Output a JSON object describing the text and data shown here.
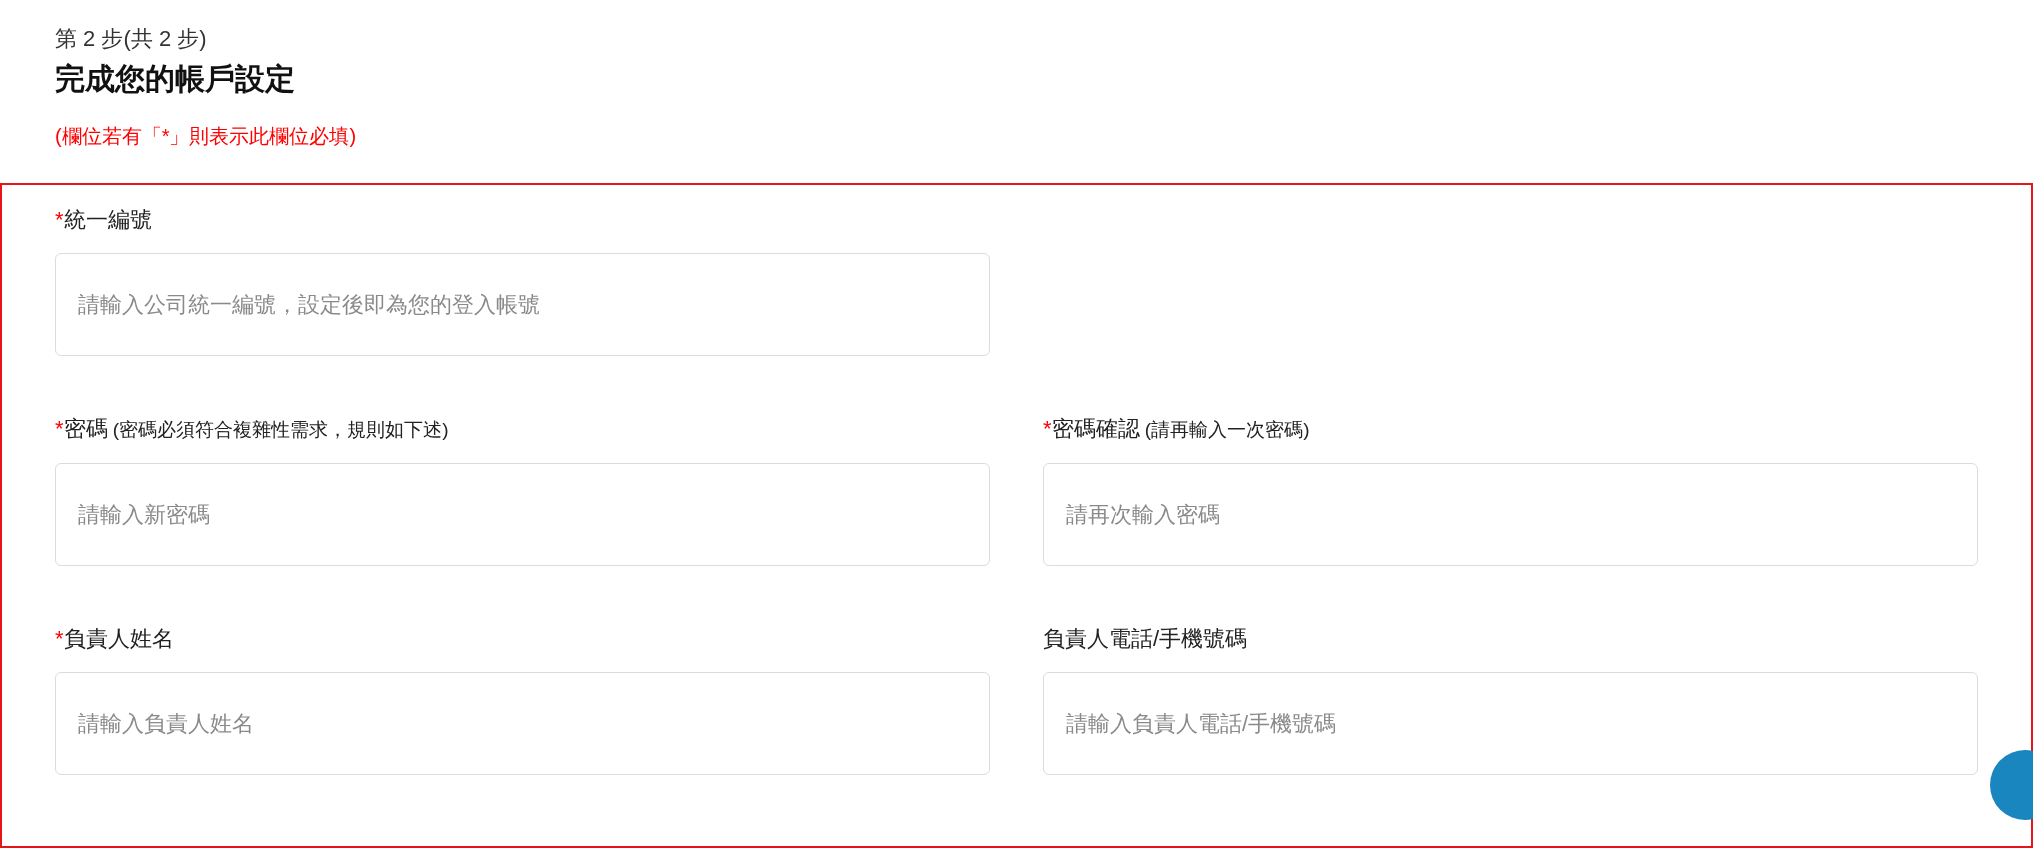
{
  "step": "第 2 步(共 2 步)",
  "title": "完成您的帳戶設定",
  "required_note": "(欄位若有「*」則表示此欄位必填)",
  "form": {
    "rows": [
      [
        {
          "marker": "*",
          "label": "統一編號",
          "placeholder": "請輸入公司統一編號，設定後即為您的登入帳號"
        }
      ],
      [
        {
          "marker": "*",
          "label": "密碼",
          "hint": "(密碼必須符合複雜性需求，規則如下述)",
          "placeholder": "請輸入新密碼"
        },
        {
          "marker": "*",
          "label": "密碼確認",
          "hint": "(請再輸入一次密碼)",
          "placeholder": "請再次輸入密碼"
        }
      ],
      [
        {
          "marker": "*",
          "label": "負責人姓名",
          "placeholder": "請輸入負責人姓名"
        },
        {
          "label": "負責人電話/手機號碼",
          "placeholder": "請輸入負責人電話/手機號碼"
        }
      ]
    ]
  }
}
